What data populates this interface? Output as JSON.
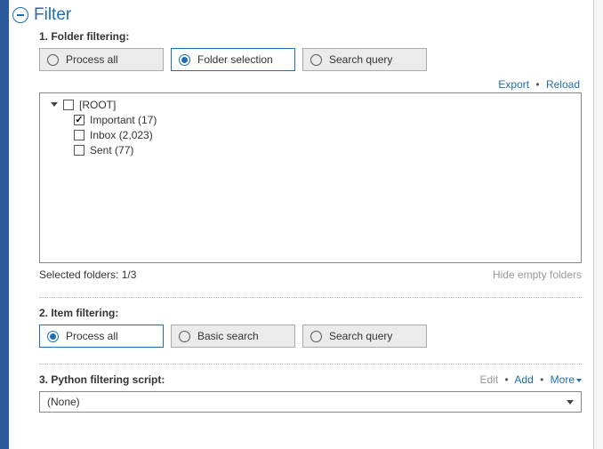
{
  "header": {
    "title": "Filter"
  },
  "folder_filtering": {
    "label": "1. Folder filtering:",
    "options": {
      "process_all": "Process all",
      "folder_selection": "Folder selection",
      "search_query": "Search query"
    },
    "links": {
      "export": "Export",
      "reload": "Reload"
    },
    "tree": {
      "root": "[ROOT]",
      "children": [
        {
          "label": "Important (17)",
          "checked": true
        },
        {
          "label": "Inbox (2,023)",
          "checked": false
        },
        {
          "label": "Sent (77)",
          "checked": false
        }
      ]
    },
    "status": "Selected folders: 1/3",
    "hide_empty": "Hide empty folders"
  },
  "item_filtering": {
    "label": "2. Item filtering:",
    "options": {
      "process_all": "Process all",
      "basic_search": "Basic search",
      "search_query": "Search query"
    }
  },
  "python_script": {
    "label": "3. Python filtering script:",
    "links": {
      "edit": "Edit",
      "add": "Add",
      "more": "More"
    },
    "value": "(None)"
  }
}
